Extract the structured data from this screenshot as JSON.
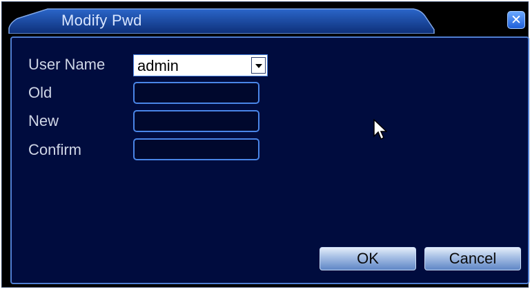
{
  "dialog": {
    "title": "Modify Pwd",
    "close_symbol": "✕",
    "accent_color": "#4a86e8",
    "background_color": "#000c3e"
  },
  "form": {
    "user_name_label": "User Name",
    "user_name_value": "admin",
    "old_label": "Old",
    "old_value": "",
    "new_label": "New",
    "new_value": "",
    "confirm_label": "Confirm",
    "confirm_value": ""
  },
  "buttons": {
    "ok_label": "OK",
    "cancel_label": "Cancel"
  },
  "icons": {
    "dropdown": "chevron-down-icon",
    "close": "close-icon",
    "pointer": "mouse-cursor-icon"
  }
}
